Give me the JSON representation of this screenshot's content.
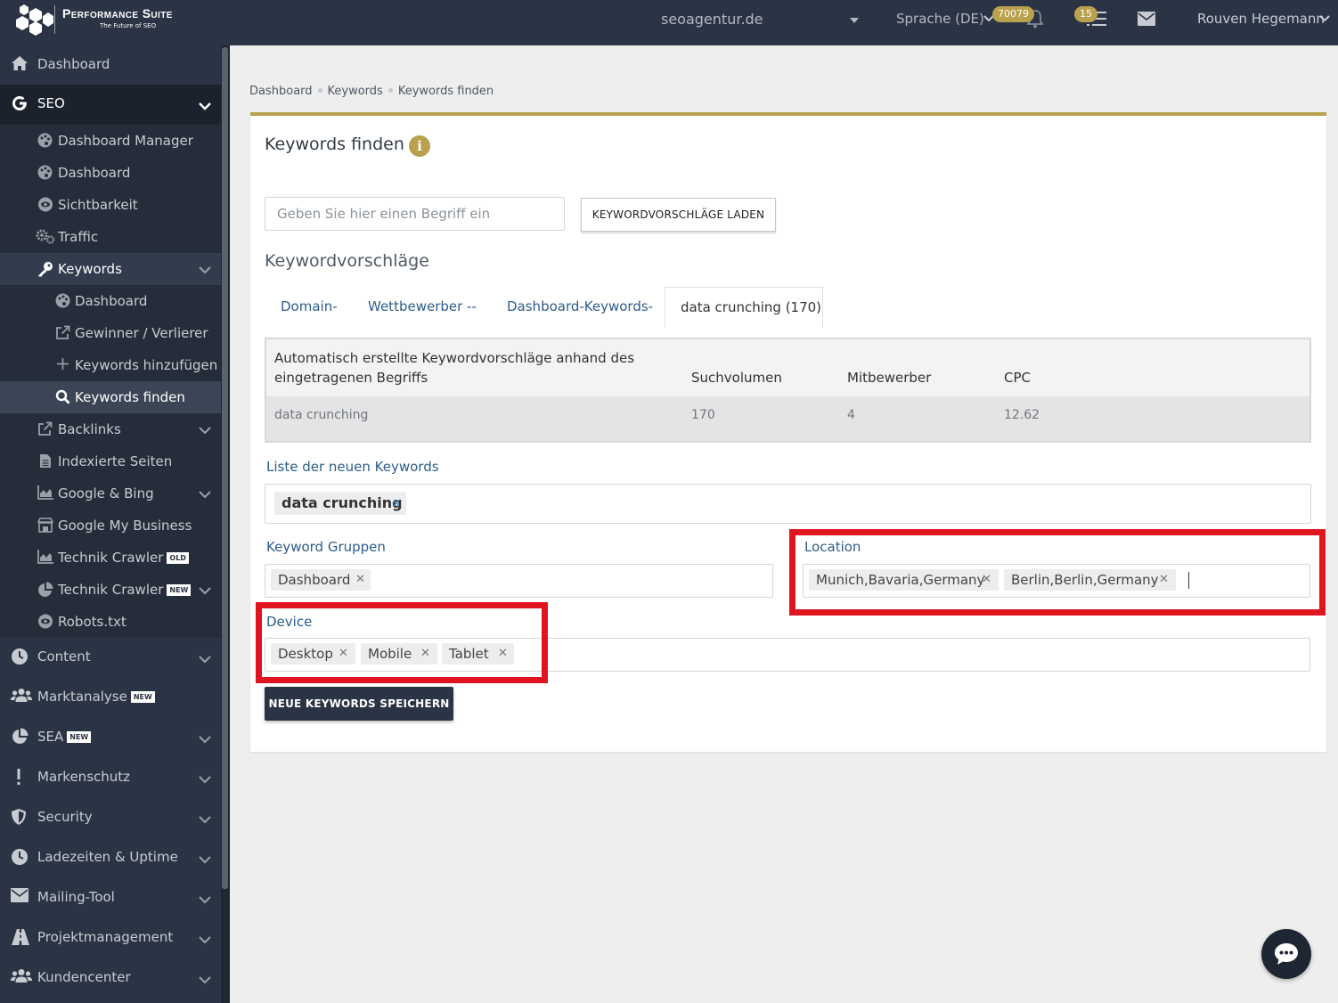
{
  "brand": {
    "title": "Performance Suite",
    "subtitle": "The Future of SEO"
  },
  "topbar": {
    "domain": "seoagentur.de",
    "language": "Sprache (DE)",
    "notifications_count": "70079",
    "tasks_count": "15",
    "user": "Rouven Hegemann"
  },
  "sidebar": {
    "dashboard": "Dashboard",
    "seo": "SEO",
    "seo_items": {
      "dashboard_manager": "Dashboard Manager",
      "dashboard": "Dashboard",
      "sichtbarkeit": "Sichtbarkeit",
      "traffic": "Traffic",
      "keywords": "Keywords",
      "kw_dashboard": "Dashboard",
      "kw_gewinner": "Gewinner / Verlierer",
      "kw_hinzufuegen": "Keywords hinzufügen",
      "kw_finden": "Keywords finden",
      "backlinks": "Backlinks",
      "indexierte_seiten": "Indexierte Seiten",
      "google_bing": "Google & Bing",
      "google_my_business": "Google My Business",
      "technik_crawler_old": "Technik Crawler",
      "technik_crawler_new": "Technik Crawler",
      "robots": "Robots.txt"
    },
    "tag_old": "OLD",
    "tag_new": "NEW",
    "content": "Content",
    "marktanalyse": "Marktanalyse",
    "sea": "SEA",
    "markenschutz": "Markenschutz",
    "security": "Security",
    "ladezeiten": "Ladezeiten & Uptime",
    "mailing": "Mailing-Tool",
    "projektmanagement": "Projektmanagement",
    "kundencenter": "Kundencenter"
  },
  "breadcrumb": [
    "Dashboard",
    "Keywords",
    "Keywords finden"
  ],
  "main": {
    "title": "Keywords finden",
    "search_placeholder": "Geben Sie hier einen Begriff ein",
    "load_button": "KEYWORDVORSCHLÄGE LADEN",
    "suggestions_title": "Keywordvorschläge",
    "tabs": [
      "Domain-",
      "Wettbewerber --",
      "Dashboard-Keywords-",
      "data crunching (170)"
    ],
    "table": {
      "headers": [
        "Automatisch erstellte Keywordvorschläge anhand des eingetragenen Begriffs",
        "Suchvolumen",
        "Mitbewerber",
        "CPC"
      ],
      "rows": [
        [
          "data crunching",
          "170",
          "4",
          "12.62"
        ]
      ]
    },
    "new_keywords_label": "Liste der neuen Keywords",
    "new_keywords": [
      "data crunching"
    ],
    "groups_label": "Keyword Gruppen",
    "groups": [
      "Dashboard"
    ],
    "location_label": "Location",
    "locations": [
      "Munich,Bavaria,Germany",
      "Berlin,Berlin,Germany"
    ],
    "device_label": "Device",
    "devices": [
      "Desktop",
      "Mobile",
      "Tablet"
    ],
    "save_button": "NEUE KEYWORDS SPEICHERN"
  },
  "colors": {
    "sidebar_bg": "#2b3444",
    "accent_gold": "#b9a14d",
    "link_blue": "#2c5d8a",
    "highlight_red": "#e0141f"
  }
}
